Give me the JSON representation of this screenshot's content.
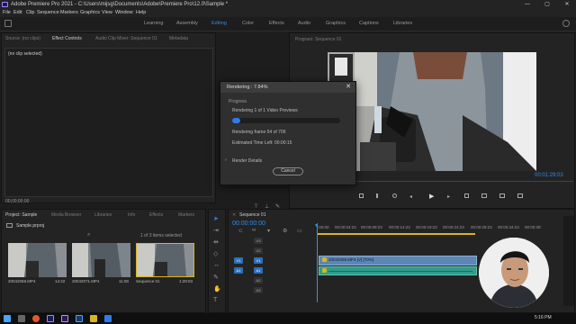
{
  "window": {
    "title": "Adobe Premiere Pro 2021 - C:\\Users\\mijsg\\Documents\\Adobe\\Premiere Pro\\12.0\\Sample *",
    "min": "—",
    "max": "▢",
    "close": "✕"
  },
  "menu": [
    "File",
    "Edit",
    "Clip",
    "Sequence",
    "Markers",
    "Graphics",
    "View",
    "Window",
    "Help"
  ],
  "workspaces": [
    {
      "label": "Learning",
      "active": false
    },
    {
      "label": "Assembly",
      "active": false
    },
    {
      "label": "Editing",
      "active": true
    },
    {
      "label": "Color",
      "active": false
    },
    {
      "label": "Effects",
      "active": false
    },
    {
      "label": "Audio",
      "active": false
    },
    {
      "label": "Graphics",
      "active": false
    },
    {
      "label": "Captions",
      "active": false
    },
    {
      "label": "Libraries",
      "active": false
    }
  ],
  "source_panel": {
    "tabs": [
      "Source: (no clips)",
      "Effect Controls",
      "Audio Clip Mixer: Sequence 01",
      "Metadata"
    ],
    "empty_text": "(no clip selected)",
    "timecode": "00;00;00;00"
  },
  "program_panel": {
    "tab": "Program: Sequence 01",
    "timecode": "00:01:29:03"
  },
  "render_dialog": {
    "title": "Rendering : 7.84%",
    "close": "✕",
    "section": "Progress",
    "line1": "Rendering 1 of 1 Video Previews",
    "progress": 0.0784,
    "line2": "Rendering frame 54 of 706",
    "line3": "Estimated Time Left: 00:00:15",
    "details": "Render Details",
    "cancel": "Cancel"
  },
  "project_panel": {
    "tabs": [
      "Project: Sample",
      "Media Browser",
      "Libraries",
      "Info",
      "Effects",
      "Markers"
    ],
    "project_file": "Sample.prproj",
    "count": "1 of 3 items selected",
    "items": [
      {
        "name": "20042069.MP4",
        "duration": "14:22"
      },
      {
        "name": "20042071.MP4",
        "duration": "11:08"
      },
      {
        "name": "Sequence 01",
        "duration": "1:29:03"
      }
    ]
  },
  "timeline": {
    "tab": "Sequence 01",
    "timecode": "00:00:00:00",
    "ruler": [
      ":00:00",
      "00:00:04:23",
      "00:00:09:23",
      "00:00:14:23",
      "00:00:19:23",
      "00:00:24:23",
      "00:00:29:23",
      "00:00:34:23",
      "00:00:39:"
    ],
    "tracks": [
      {
        "id": "V3",
        "src": ""
      },
      {
        "id": "V2",
        "src": ""
      },
      {
        "id": "V1",
        "src": "V1"
      },
      {
        "id": "A1",
        "src": "A1"
      },
      {
        "id": "A2",
        "src": ""
      },
      {
        "id": "A3",
        "src": ""
      }
    ],
    "clip_label": "20042069.MP4 [V] [70%]"
  },
  "taskbar": {
    "time": "5:16 PM"
  },
  "colors": {
    "accent": "#2d8ceb",
    "clip_video": "#5d86b5",
    "clip_audio": "#2f9c8a",
    "render_bar": "#d9b51f",
    "playhead": "#3b8df0"
  }
}
